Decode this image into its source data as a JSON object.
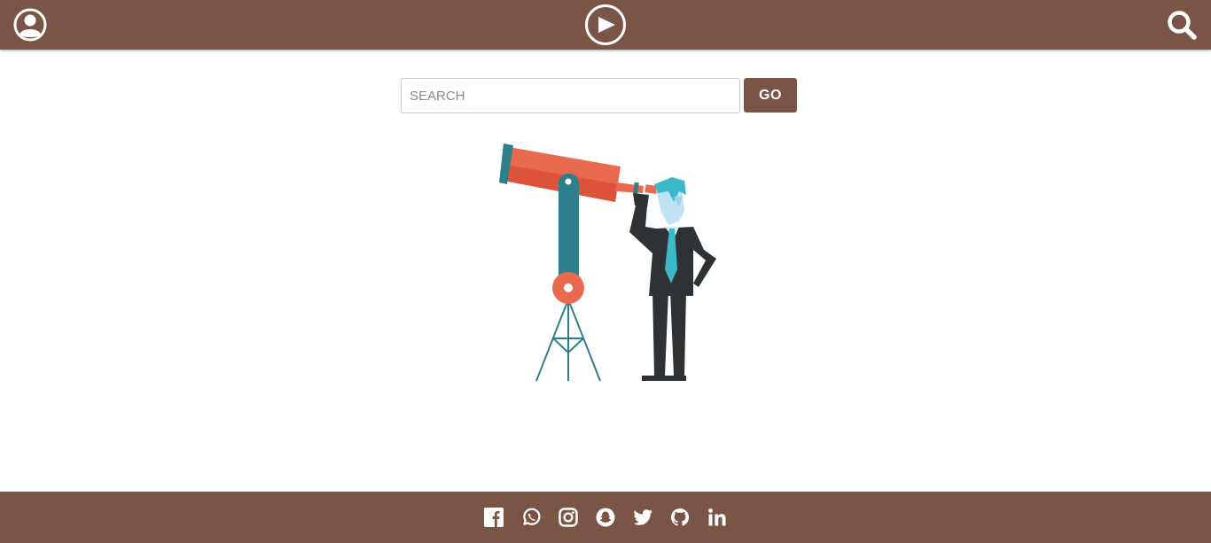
{
  "header": {
    "user_icon": "user-circle-icon",
    "logo_icon": "play-circle-icon",
    "search_icon": "search-icon"
  },
  "search": {
    "placeholder": "SEARCH",
    "value": "",
    "go_label": "GO"
  },
  "illustration": {
    "subject": "businessman-looking-through-telescope"
  },
  "footer": {
    "social": [
      "facebook",
      "whatsapp",
      "instagram",
      "snapchat",
      "twitter",
      "github",
      "linkedin"
    ]
  },
  "colors": {
    "brand": "#7a5545",
    "telescope": "#ea6a4f",
    "teal": "#2e7f8c",
    "suit": "#2f3234",
    "tie": "#3cb9c9"
  }
}
